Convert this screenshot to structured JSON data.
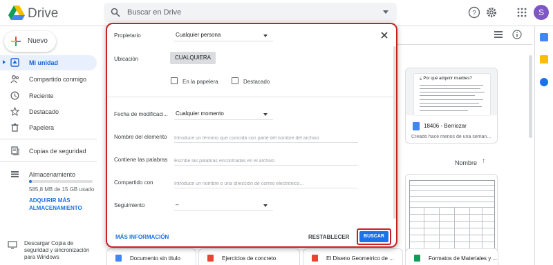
{
  "app": {
    "title": "Drive",
    "avatar_letter": "S"
  },
  "search": {
    "placeholder": "Buscar en Drive"
  },
  "sidebar": {
    "new_label": "Nuevo",
    "items": [
      {
        "label": "Mi unidad",
        "icon": "my-drive-icon"
      },
      {
        "label": "Compartido conmigo",
        "icon": "people-icon"
      },
      {
        "label": "Reciente",
        "icon": "clock-icon"
      },
      {
        "label": "Destacado",
        "icon": "star-icon"
      },
      {
        "label": "Papelera",
        "icon": "trash-icon"
      },
      {
        "label": "Copias de seguridad",
        "icon": "backup-icon"
      },
      {
        "label": "Almacenamiento",
        "icon": "storage-icon"
      }
    ],
    "storage_text": "585,8 MB de 15 GB usado",
    "storage_fraction": 0.04,
    "upgrade_label": "ADQUIRIR MÁS ALMACENAMIENTO",
    "download_text": "Descargar Copia de seguridad y sincronización para Windows"
  },
  "main": {
    "card": {
      "preview_title": "¿ Por qué adquirir muebles?",
      "title": "18406 - Berriozar",
      "subtitle": "Creado hace menos de una seman..."
    },
    "sort_label": "Nombre",
    "sort_arrow": "↑",
    "files": [
      {
        "name": "Documento sin título",
        "color": "#4285f4"
      },
      {
        "name": "Ejercicios de concreto",
        "color": "#ea4335"
      },
      {
        "name": "El Diseno Geometrico de ...",
        "color": "#ea4335"
      },
      {
        "name": "Formatos de Materiales y ...",
        "color": "#0f9d58"
      }
    ]
  },
  "dialog": {
    "owner_label": "Propietario",
    "owner_value": "Cualquier persona",
    "location_label": "Ubicación",
    "location_chip": "CUALQUIERA",
    "trash_label": "En la papelera",
    "starred_label": "Destacado",
    "modified_label": "Fecha de modificaci...",
    "modified_value": "Cualquier momento",
    "name_label": "Nombre del elemento",
    "name_placeholder": "Introduce un término que coincida con parte del nombre del archivo",
    "words_label": "Contiene las palabras",
    "words_placeholder": "Escribe las palabras encontradas en el archivo",
    "shared_label": "Compartido con",
    "shared_placeholder": "Introduce un nombre o una dirección de correo electrónico...",
    "followup_label": "Seguimiento",
    "followup_value": "–",
    "more_info": "MÁS INFORMACIÓN",
    "reset": "RESTABLECER",
    "search_button": "BUSCAR"
  },
  "colors": {
    "accent": "#1a73e8",
    "highlight": "#c5221f",
    "active_bg": "#e8f0fe"
  }
}
